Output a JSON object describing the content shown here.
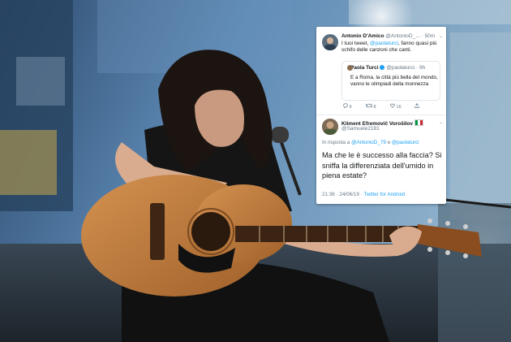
{
  "tweet_card": {
    "original": {
      "display_name": "Antonio D'Amico",
      "handle": "@AntonioD_...",
      "time": "50m",
      "text_prefix": "I tuoi tweet, ",
      "mention": "@paolaturci",
      "text_suffix": ", fanno quasi più schifo delle canzoni che canti."
    },
    "quoted": {
      "display_name": "Paola Turci",
      "handle": "@paolaturci",
      "time": "9h",
      "text": "E a Roma, la città più bella del mondo, vanno le olimpiadi della monnezza"
    },
    "actions": {
      "replies": "9",
      "retweets": "8",
      "likes": "16"
    },
    "reply": {
      "display_name": "Kliment Efremovič Vorošilov",
      "handle": "@Samuele2181",
      "reply_prefix": "In risposta a ",
      "reply_to_1": "@AntonioD_79",
      "reply_join": " e ",
      "reply_to_2": "@paolaturci",
      "text": "Ma che le è successo alla faccia? Si sniffa la differenziata dell'umido in piena estate?",
      "timestamp": "21:36 · 24/06/19 · ",
      "source": "Twitter for Android"
    }
  },
  "icons": {
    "reply": "reply-icon",
    "retweet": "retweet-icon",
    "like": "heart-icon",
    "share": "share-icon",
    "verified": "verified-badge-icon",
    "flag": "italy-flag-icon"
  },
  "colors": {
    "twitter_blue": "#1da1f2",
    "muted_text": "#657786",
    "card_bg": "#ffffff"
  }
}
